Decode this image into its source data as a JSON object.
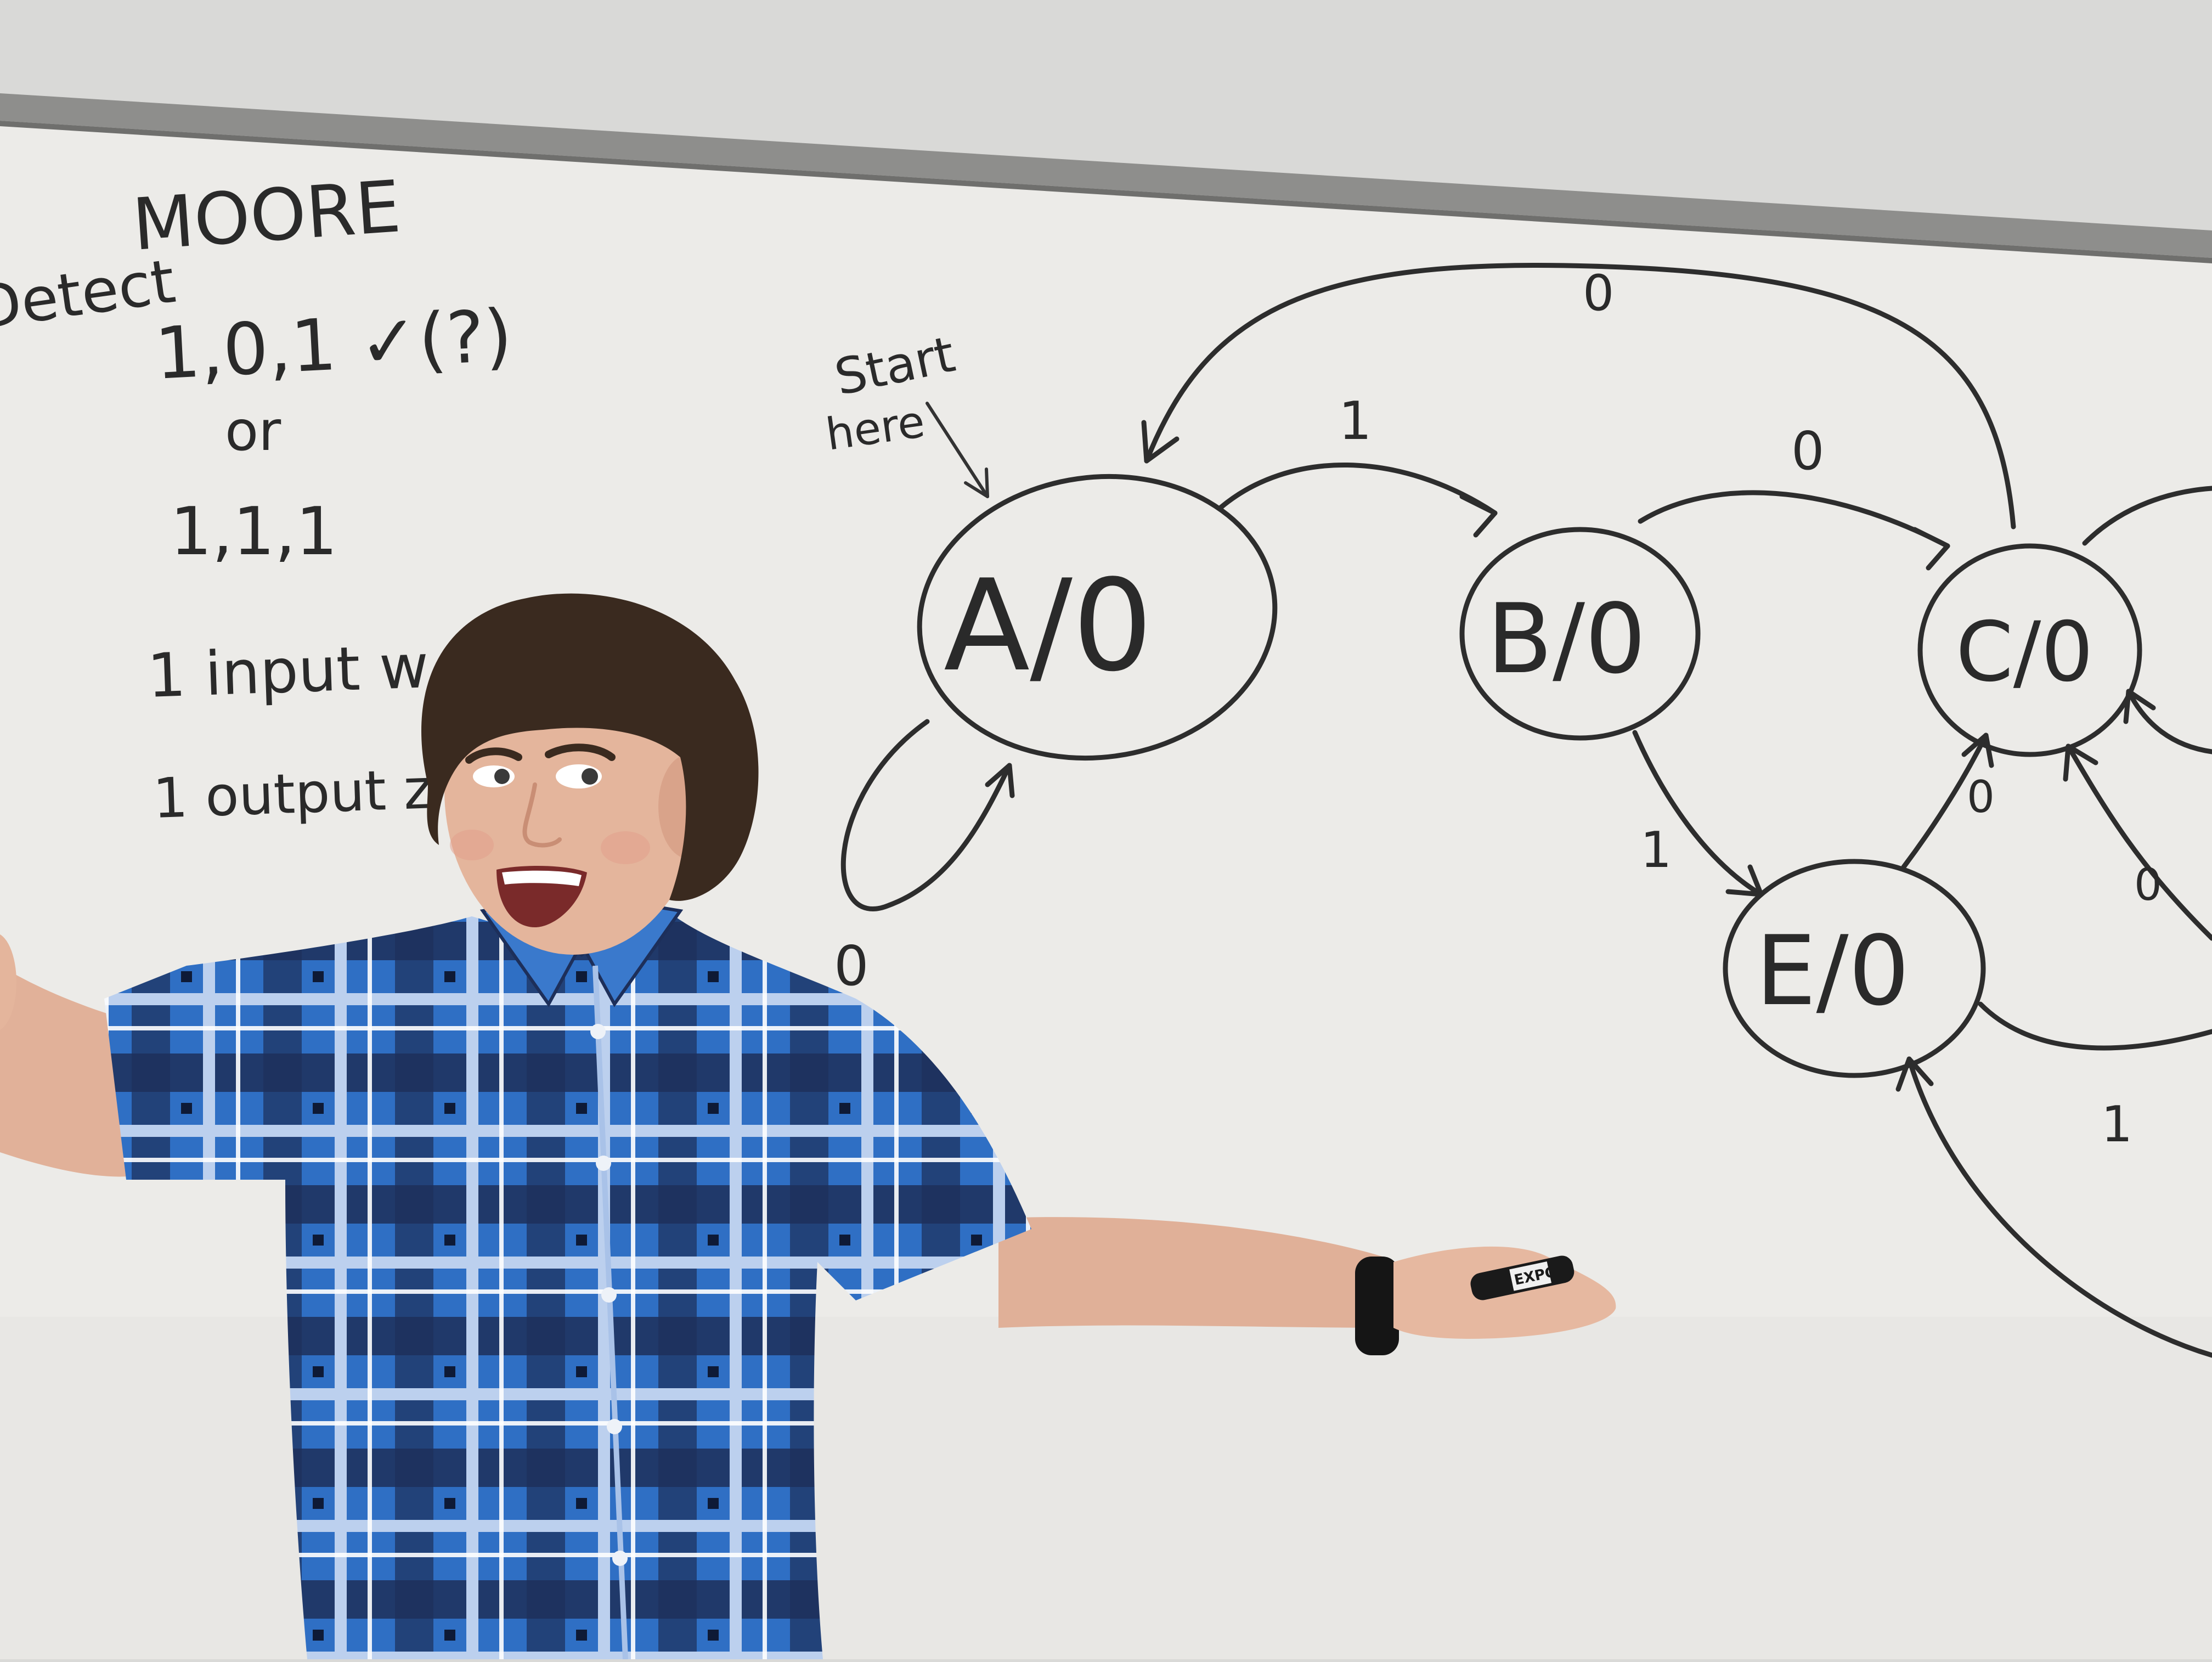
{
  "colors": {
    "wall": "#d9d9d7",
    "board": "#ecebe8",
    "rail": "#8e8e8c",
    "ink": "#2d2d2d",
    "shirt_blue": "#2f6fc4",
    "shirt_navy": "#1d2f5a",
    "shirt_light": "#bcd0ee",
    "skin": "#e4b59c",
    "hair": "#3a2a1f",
    "marker": "#1a1a1a"
  },
  "notes": {
    "title": "MOORE",
    "detect": "Detect",
    "seq1": "1,0,1 ✓(?)",
    "or": "or",
    "seq2": "1,1,1",
    "input": "1 input w",
    "output": "1 output z"
  },
  "start_label": {
    "line1": "Start",
    "line2": "here"
  },
  "states": [
    {
      "id": "A",
      "label": "A/0"
    },
    {
      "id": "B",
      "label": "B/0"
    },
    {
      "id": "C",
      "label": "C/0"
    },
    {
      "id": "E",
      "label": "E/0"
    }
  ],
  "transitions": [
    {
      "from": "C",
      "to": "A",
      "label": "0"
    },
    {
      "from": "A",
      "to": "B",
      "label": "1"
    },
    {
      "from": "B",
      "to": "C",
      "label": "0"
    },
    {
      "from": "A",
      "to": "A",
      "label": "0"
    },
    {
      "from": "B",
      "to": "E",
      "label": "1"
    },
    {
      "from": "E",
      "to": "C",
      "label": "0"
    },
    {
      "from": "offscreen",
      "to": "C",
      "label": "0"
    },
    {
      "from": "offscreen",
      "to": "E",
      "label": "1"
    }
  ],
  "marker_brand": "EXPO"
}
